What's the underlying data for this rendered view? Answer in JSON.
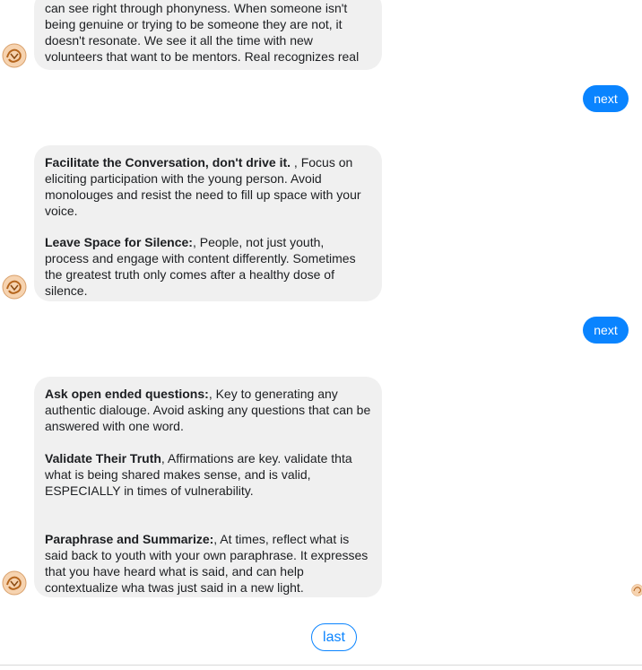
{
  "messages": [
    {
      "type": "bot",
      "text": "can see right through phonyness. When someone isn't being genuine or trying to be someone they are not, it doesn't resonate. We see it all the time with new volunteers that want to be mentors. Real recognizes real"
    },
    {
      "type": "user",
      "label": "next"
    },
    {
      "type": "bot",
      "paragraphs": [
        {
          "bold": "Facilitate the Conversation, don't drive it.",
          "text": " , Focus on eliciting participation with the young person. Avoid monolouges and resist the need to fill up space with your voice."
        },
        {
          "bold": "Leave Space for Silence:",
          "text": ", People, not just youth, process and engage with content differently. Sometimes the greatest truth only comes after a healthy dose of silence."
        }
      ]
    },
    {
      "type": "user",
      "label": "next"
    },
    {
      "type": "bot",
      "paragraphs": [
        {
          "bold": "Ask open ended questions:",
          "text": ", Key to generating any authentic dialouge. Avoid asking any questions that can be answered with one word."
        },
        {
          "bold": "Validate Their Truth",
          "text": ", Affirmations are key. validate thta what is being shared makes sense, and is valid, ESPECIALLY in times of vulnerability."
        },
        {
          "bold": "Paraphrase and Summarize:",
          "text": ", At times, reflect what is said back to youth with your own paraphrase. It expresses that you have heard what is said, and can help contextualize wha twas just said in a new light."
        }
      ]
    }
  ],
  "quick_reply": {
    "label": "last"
  },
  "colors": {
    "accent": "#0a84ff",
    "bubble": "#f0f0f0",
    "text": "#1c1e21"
  },
  "icons": {
    "avatar": "bot-avatar-icon"
  }
}
